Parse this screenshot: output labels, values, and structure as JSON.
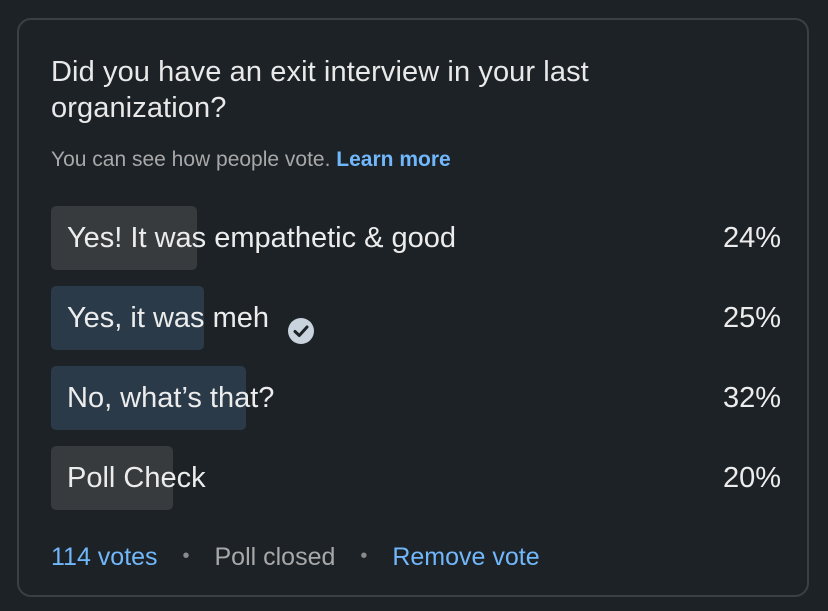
{
  "poll": {
    "question": "Did you have an exit interview in your last organization?",
    "visibility_note": "You can see how people vote.",
    "learn_more": "Learn more",
    "options": [
      {
        "label": "Yes! It was empathetic & good",
        "percent": "24%",
        "value": 24,
        "selected": false
      },
      {
        "label": "Yes, it was meh",
        "percent": "25%",
        "value": 25,
        "selected": true
      },
      {
        "label": "No, what’s that?",
        "percent": "32%",
        "value": 32,
        "selected": false
      },
      {
        "label": "Poll Check",
        "percent": "20%",
        "value": 20,
        "selected": false
      }
    ],
    "votes": "114 votes",
    "separator": "•",
    "status": "Poll closed",
    "remove_vote": "Remove vote"
  },
  "icons": {
    "selected_indicator": "check-circle-icon"
  },
  "colors": {
    "background": "#1d2226",
    "link": "#71b7fb",
    "bar": "#373b3e",
    "bar_highlight": "#2b3a48"
  }
}
